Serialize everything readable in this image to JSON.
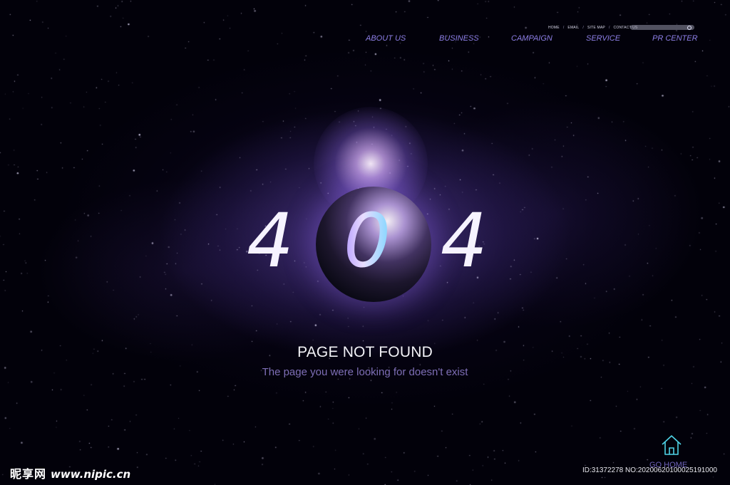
{
  "top_links": [
    "HOME",
    "EMAIL",
    "SITE MAP",
    "CONTACT US"
  ],
  "top_links_separator": "/",
  "search": {
    "icon": "search-icon"
  },
  "main_nav": [
    "ABOUT US",
    "BUSINESS",
    "CAMPAIGN",
    "SERVICE",
    "PR CENTER"
  ],
  "error": {
    "code": [
      "4",
      "0",
      "4"
    ],
    "title": "PAGE NOT FOUND",
    "message": "The page you were looking for doesn't exist"
  },
  "go_home": {
    "label": "GO HOME",
    "icon": "house-icon"
  },
  "watermark": {
    "site_name": "昵享网",
    "site_url": "www.nipic.cn",
    "image_id": "ID:31372278 NO:20200620100025191000"
  },
  "colors": {
    "nav": "#8d7fe6",
    "message": "#7e6fb6",
    "go_home_icon": "#4fd3e6",
    "background": "#02010a"
  }
}
